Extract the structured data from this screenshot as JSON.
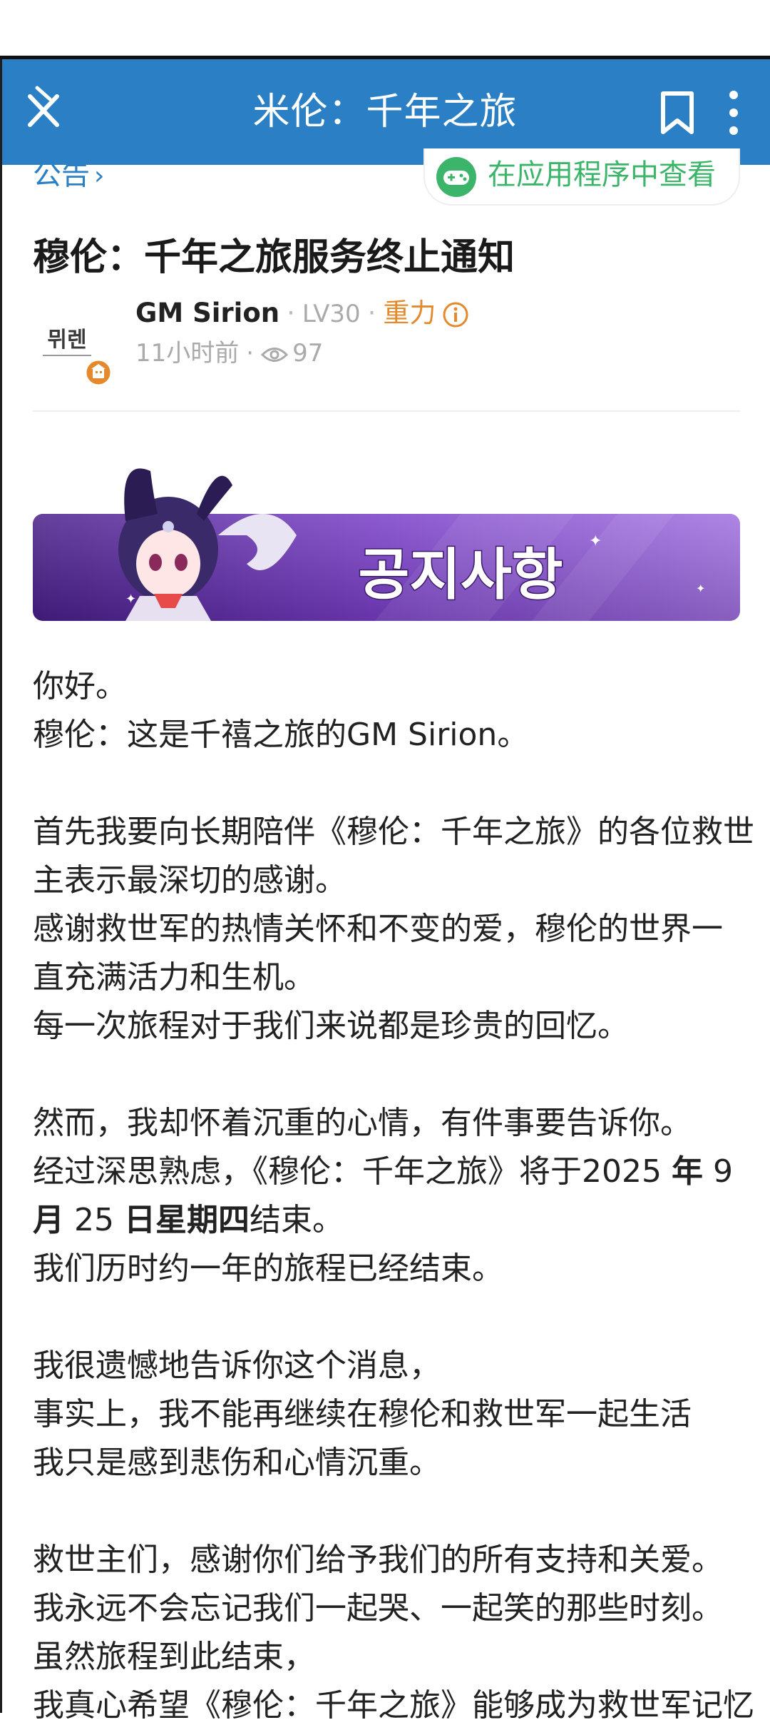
{
  "header": {
    "title": "米伦：千年之旅",
    "close_icon": "close-icon",
    "bookmark_icon": "bookmark-icon",
    "more_icon": "more-vertical-icon",
    "color": "#2b7fc4"
  },
  "breadcrumb": {
    "label": "公告",
    "chevron": "›"
  },
  "app_button": {
    "label": "在应用程序中查看",
    "icon": "gamepad-icon",
    "color": "#3cb56a"
  },
  "post": {
    "title": "穆伦：千年之旅服务终止通知",
    "author": {
      "name": "GM Sirion",
      "level": "LV30",
      "badge": "重力",
      "avatar_text": "뮈렌"
    },
    "time": "11小时前",
    "views": "97",
    "banner_text": "공지사항"
  },
  "content": {
    "p1": "你好。",
    "p2": "穆伦：这是千禧之旅的GM Sirion。",
    "p3": "首先我要向长期陪伴《穆伦：千年之旅》的各位救世",
    "p4": "主表示最深切的感谢。",
    "p5": "感谢救世军的热情关怀和不变的爱，穆伦的世界一",
    "p6": "直充满活力和生机。",
    "p7": "每一次旅程对于我们来说都是珍贵的回忆。",
    "p8": "然而，我却怀着沉重的心情，有件事要告诉你。",
    "p9a": "经过深思熟虑，《穆伦：千年之旅》将于2025 ",
    "p9b": "年",
    "p9c": " 9",
    "p10a": "月",
    "p10b": " 25 ",
    "p10c": "日星期四",
    "p10d": "结束。",
    "p11": "我们历时约一年的旅程已经结束。",
    "p12": "我很遗憾地告诉你这个消息，",
    "p13": "事实上，我不能再继续在穆伦和救世军一起生活",
    "p14": "我只是感到悲伤和心情沉重。",
    "p15": "救世主们，感谢你们给予我们的所有支持和关爱。",
    "p16": "我永远不会忘记我们一起哭、一起笑的那些时刻。",
    "p17": "虽然旅程到此结束，",
    "p18": "我真心希望《穆伦：千年之旅》能够成为救世军记忆"
  }
}
